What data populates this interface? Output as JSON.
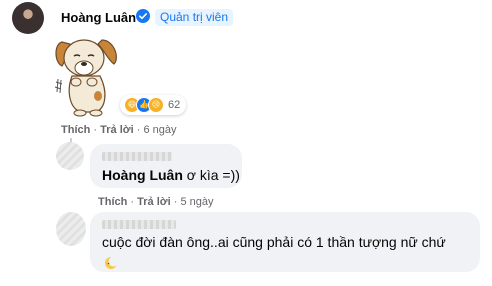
{
  "post": {
    "author": "Hoàng Luân",
    "verified_icon": "check-circle-icon",
    "role": "Quản trị viên",
    "sticker": "dog-sticker",
    "reactions": {
      "icons": [
        "haha-icon",
        "like-icon",
        "sad-icon"
      ],
      "count": "62"
    },
    "actions": {
      "like": "Thích",
      "reply": "Trả lời",
      "time": "6 ngày"
    }
  },
  "replies": [
    {
      "mention": "Hoàng Luân",
      "text": " ơ kìa =))",
      "actions": {
        "like": "Thích",
        "reply": "Trả lời",
        "time": "5 ngày"
      }
    },
    {
      "text": "cuộc đời đàn ông..ai cũng phải có 1 thần tượng nữ chứ",
      "emoji_icon": "crescent-moon-icon"
    }
  ],
  "colors": {
    "link": "#1877f2",
    "bubble": "#f0f2f5",
    "muted": "#65676b"
  }
}
